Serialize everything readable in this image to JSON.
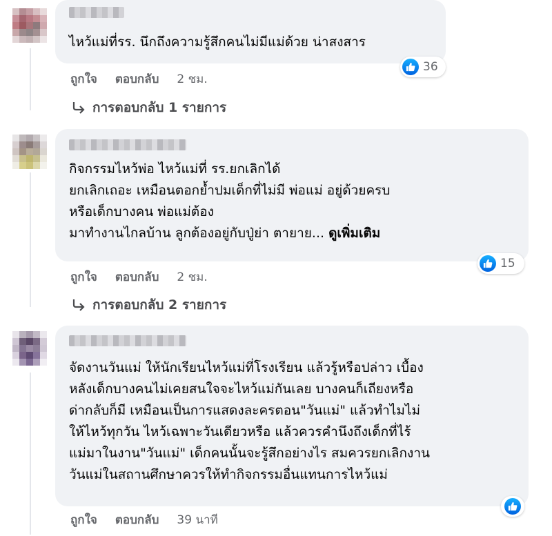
{
  "comments": [
    {
      "author": "",
      "text": "ไหว้แม่ที่รร. นึกถึงความรู้สึกคนไม่มีแม่ด้วย น่าสงสาร",
      "see_more": "",
      "reactions": {
        "icon": "like-icon",
        "count": "36"
      },
      "actions": {
        "like": "ถูกใจ",
        "reply": "ตอบกลับ",
        "time": "2 ชม."
      },
      "replies_label": "การตอบกลับ 1 รายการ"
    },
    {
      "author": "",
      "text": "กิจกรรมไหว้พ่อ ไหว้แม่ที่ รร.ยกเลิกได้\nยกเลิกเถอะ เหมือนตอกย้ำปมเด็กที่ไม่มี พ่อแม่ อยู่ด้วยครบ\nหรือเด็กบางคน พ่อแม่ต้อง\nมาทำงานไกลบ้าน ลูกต้องอยู่กับปู่ย่า ตายาย... ",
      "see_more": "ดูเพิ่มเติม",
      "reactions": {
        "icon": "like-icon",
        "count": "15"
      },
      "actions": {
        "like": "ถูกใจ",
        "reply": "ตอบกลับ",
        "time": "2 ชม."
      },
      "replies_label": "การตอบกลับ 2 รายการ"
    },
    {
      "author": "",
      "text": "จัดงานวันแม่ ให้นักเรียนไหว้แม่ที่โรงเรียน แล้วรู้หรือปล่าว เบื้อง\nหลังเด็กบางคนไม่เคยสนใจจะไหว้แม่กันเลย บางคนก็เถียงหรือ\nด่ากลับก็มี เหมือนเป็นการแสดงละครตอน\"วันแม่\" แล้วทำไมไม่\nให้ไหว้ทุกวัน ไหว้เฉพาะวันเดียวหรือ แล้วควรคำนึงถึงเด็กที่ไร้\nแม่มาในงาน\"วันแม่\" เด็กคนนั้นจะรู้สึกอย่างไร สมควรยกเลิกงาน\nวันแม่ในสถานศึกษาควรให้ทำกิจกรรมอื่นแทนการไหว้แม่",
      "see_more": "",
      "reactions": {
        "icon": "like-icon",
        "count": ""
      },
      "actions": {
        "like": "ถูกใจ",
        "reply": "ตอบกลับ",
        "time": "39 นาที"
      },
      "replies_label": ""
    }
  ],
  "colors": {
    "bubble": "#f0f2f5",
    "action_text": "#65676b",
    "like_blue": "#0866ff"
  }
}
